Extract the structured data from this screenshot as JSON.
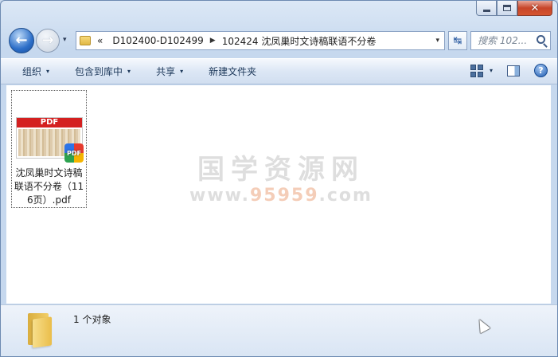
{
  "window": {
    "controls": {
      "minimize": "minimize-icon",
      "maximize": "maximize-icon",
      "close": "✕"
    }
  },
  "nav": {
    "back_icon": "←",
    "forward_icon": "→",
    "history_dropdown": "▾",
    "breadcrumbs": [
      "«",
      "D102400-D102499",
      "102424 沈凤巢时文诗稿联语不分卷"
    ],
    "separator": "▶",
    "address_dropdown": "▾",
    "refresh_icon": "↹",
    "search_placeholder": "搜索 102..."
  },
  "toolbar": {
    "organize": "组织",
    "include_in_library": "包含到库中",
    "share": "共享",
    "new_folder": "新建文件夹",
    "dropdown": "▾",
    "help": "?"
  },
  "files": [
    {
      "thumb_header": "PDF",
      "badge": "PDF",
      "name": "沈凤巢时文诗稿联语不分卷（116页）.pdf"
    }
  ],
  "watermark": {
    "cn": "国学资源网",
    "url_prefix": "www.",
    "url_highlight": "95959",
    "url_suffix": ".com"
  },
  "status": {
    "object_count": "1 个对象"
  },
  "colors": {
    "accent": "#2c6ec8",
    "pdf_red": "#d42020",
    "toolbar_text": "#1e395b"
  }
}
